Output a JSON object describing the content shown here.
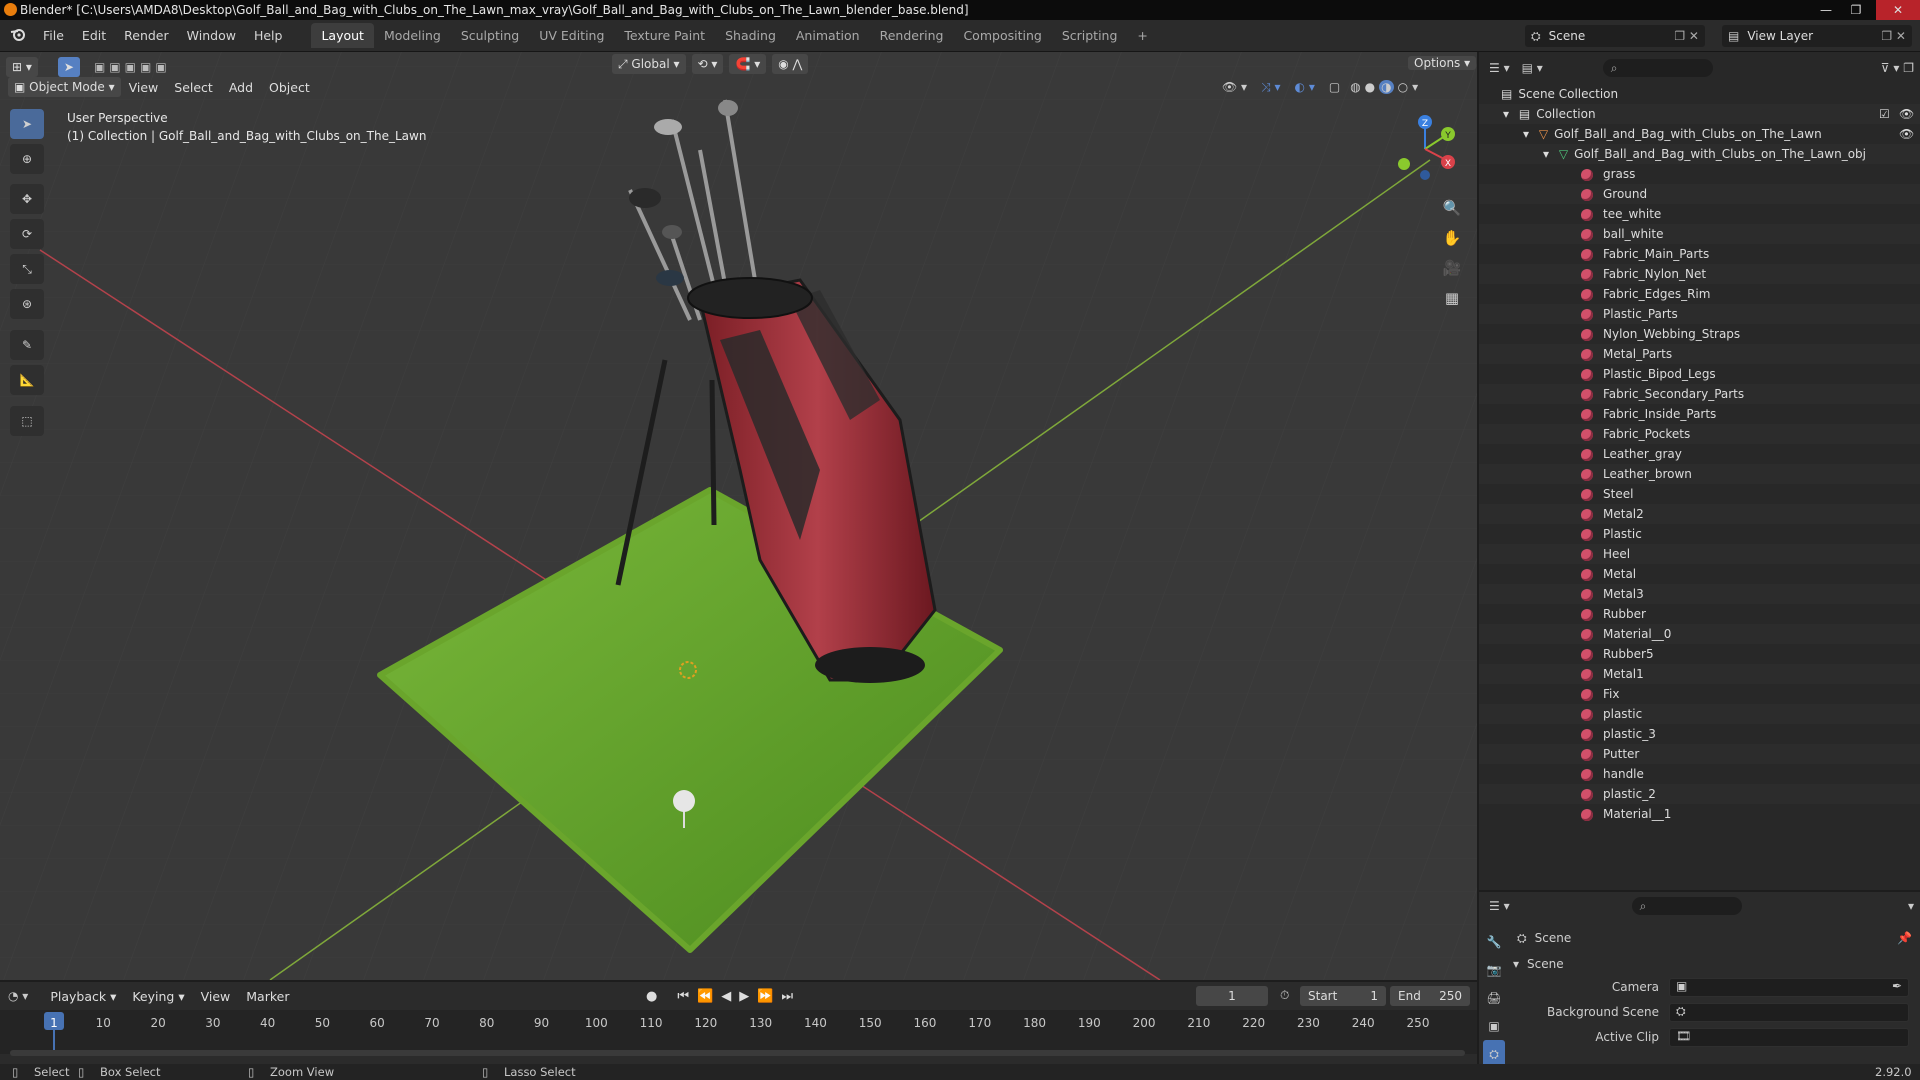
{
  "window": {
    "title": "Blender* [C:\\Users\\AMDA8\\Desktop\\Golf_Ball_and_Bag_with_Clubs_on_The_Lawn_max_vray\\Golf_Ball_and_Bag_with_Clubs_on_The_Lawn_blender_base.blend]",
    "minimize": "—",
    "maximize": "❐",
    "close": "✕"
  },
  "menu": [
    "File",
    "Edit",
    "Render",
    "Window",
    "Help"
  ],
  "workspaces": [
    "Layout",
    "Modeling",
    "Sculpting",
    "UV Editing",
    "Texture Paint",
    "Shading",
    "Animation",
    "Rendering",
    "Compositing",
    "Scripting"
  ],
  "workspace_add": "+",
  "scene_selector": "Scene",
  "view_layer_selector": "View Layer",
  "viewport": {
    "transform_orientation": "Global",
    "options": "Options",
    "mode": "Object Mode",
    "header_menus": [
      "View",
      "Select",
      "Add",
      "Object"
    ],
    "overlay_title": "User Perspective",
    "overlay_collection": "(1) Collection | Golf_Ball_and_Bag_with_Clubs_on_The_Lawn",
    "gizmo_axes": {
      "x": "X",
      "y": "Y",
      "z": "Z"
    }
  },
  "outliner": {
    "root": "Scene Collection",
    "collection": "Collection",
    "object": "Golf_Ball_and_Bag_with_Clubs_on_The_Lawn",
    "mesh": "Golf_Ball_and_Bag_with_Clubs_on_The_Lawn_obj",
    "materials": [
      "grass",
      "Ground",
      "tee_white",
      "ball_white",
      "Fabric_Main_Parts",
      "Fabric_Nylon_Net",
      "Fabric_Edges_Rim",
      "Plastic_Parts",
      "Nylon_Webbing_Straps",
      "Metal_Parts",
      "Plastic_Bipod_Legs",
      "Fabric_Secondary_Parts",
      "Fabric_Inside_Parts",
      "Fabric_Pockets",
      "Leather_gray",
      "Leather_brown",
      "Steel",
      "Metal2",
      "Plastic",
      "Heel",
      "Metal",
      "Metal3",
      "Rubber",
      "Material__0",
      "Rubber5",
      "Metal1",
      "Fix",
      "plastic",
      "plastic_3",
      "Putter",
      "handle",
      "plastic_2",
      "Material__1"
    ]
  },
  "properties": {
    "breadcrumb": "Scene",
    "panel": "Scene",
    "fields": [
      {
        "label": "Camera",
        "value": ""
      },
      {
        "label": "Background Scene",
        "value": ""
      },
      {
        "label": "Active Clip",
        "value": ""
      }
    ]
  },
  "timeline": {
    "menus": [
      "Playback",
      "Keying",
      "View",
      "Marker"
    ],
    "current_frame": "1",
    "start_label": "Start",
    "start": "1",
    "end_label": "End",
    "end": "250",
    "ticks": [
      "1",
      "10",
      "20",
      "30",
      "40",
      "50",
      "60",
      "70",
      "80",
      "90",
      "100",
      "110",
      "120",
      "130",
      "140",
      "150",
      "160",
      "170",
      "180",
      "190",
      "200",
      "210",
      "220",
      "230",
      "240",
      "250"
    ]
  },
  "status": {
    "select": "Select",
    "box_select": "Box Select",
    "zoom_view": "Zoom View",
    "lasso_select": "Lasso Select",
    "version": "2.92.0"
  },
  "colors": {
    "accent": "#4772b3",
    "grass": "#5e9a2a",
    "bag_red": "#a0323a",
    "material_icon": "#d2506a",
    "x_axis": "#d9424a",
    "y_axis": "#8ac92d",
    "z_axis": "#3a80e0"
  }
}
